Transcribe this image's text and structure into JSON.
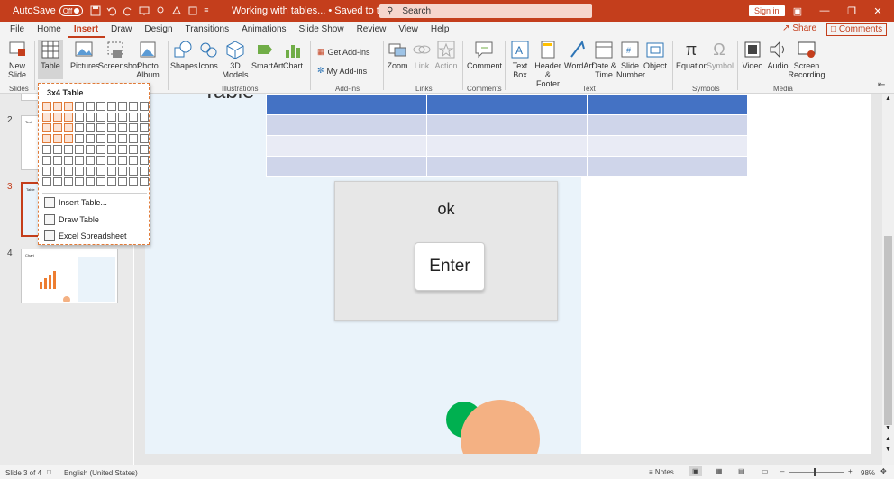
{
  "titlebar": {
    "autosave_label": "AutoSave",
    "autosave_state": "Off",
    "doc_title": "Working with tables... • Saved to this PC ˅",
    "search_placeholder": "Search",
    "signin_label": "Sign in",
    "accent_color": "#c43e1c"
  },
  "menu": {
    "tabs": [
      "File",
      "Home",
      "Insert",
      "Draw",
      "Design",
      "Transitions",
      "Animations",
      "Slide Show",
      "Review",
      "View",
      "Help"
    ],
    "active_tab": "Insert",
    "share_label": "Share",
    "comments_label": "Comments"
  },
  "ribbon": {
    "slides": {
      "new_slide": "New Slide",
      "group": "Slides"
    },
    "tables": {
      "table": "Table"
    },
    "images": {
      "pictures": "Pictures",
      "screenshot": "Screenshot",
      "photo_album": "Photo Album"
    },
    "illustrations": {
      "shapes": "Shapes",
      "icons": "Icons",
      "models": "3D Models",
      "smartart": "SmartArt",
      "chart": "Chart",
      "group": "Illustrations"
    },
    "addins": {
      "get": "Get Add-ins",
      "my": "My Add-ins",
      "group": "Add-ins"
    },
    "links": {
      "zoom": "Zoom",
      "link": "Link",
      "action": "Action",
      "group": "Links"
    },
    "comments": {
      "comment": "Comment",
      "group": "Comments"
    },
    "text": {
      "textbox": "Text Box",
      "header": "Header & Footer",
      "wordart": "WordArt",
      "datetime": "Date & Time",
      "slidenum": "Slide Number",
      "object": "Object",
      "group": "Text"
    },
    "symbols": {
      "equation": "Equation",
      "symbol": "Symbol",
      "group": "Symbols"
    },
    "media": {
      "video": "Video",
      "audio": "Audio",
      "screen_rec": "Screen Recording",
      "group": "Media"
    }
  },
  "table_dropdown": {
    "title": "3x4 Table",
    "grid_cols": 10,
    "grid_rows": 8,
    "highlight_cols": 3,
    "highlight_rows": 4,
    "items": [
      "Insert Table...",
      "Draw Table",
      "Excel Spreadsheet"
    ]
  },
  "slides": {
    "numbers": [
      "2",
      "3",
      "4"
    ],
    "selected": "3",
    "thumb_titles": [
      "Text",
      "Table",
      "Chart"
    ]
  },
  "slide_title_fragment": "Table",
  "dialog": {
    "message": "ok",
    "button": "Enter"
  },
  "statusbar": {
    "slide_info": "Slide 3 of 4",
    "language": "English (United States)",
    "notes": "Notes",
    "zoom": "98%"
  }
}
